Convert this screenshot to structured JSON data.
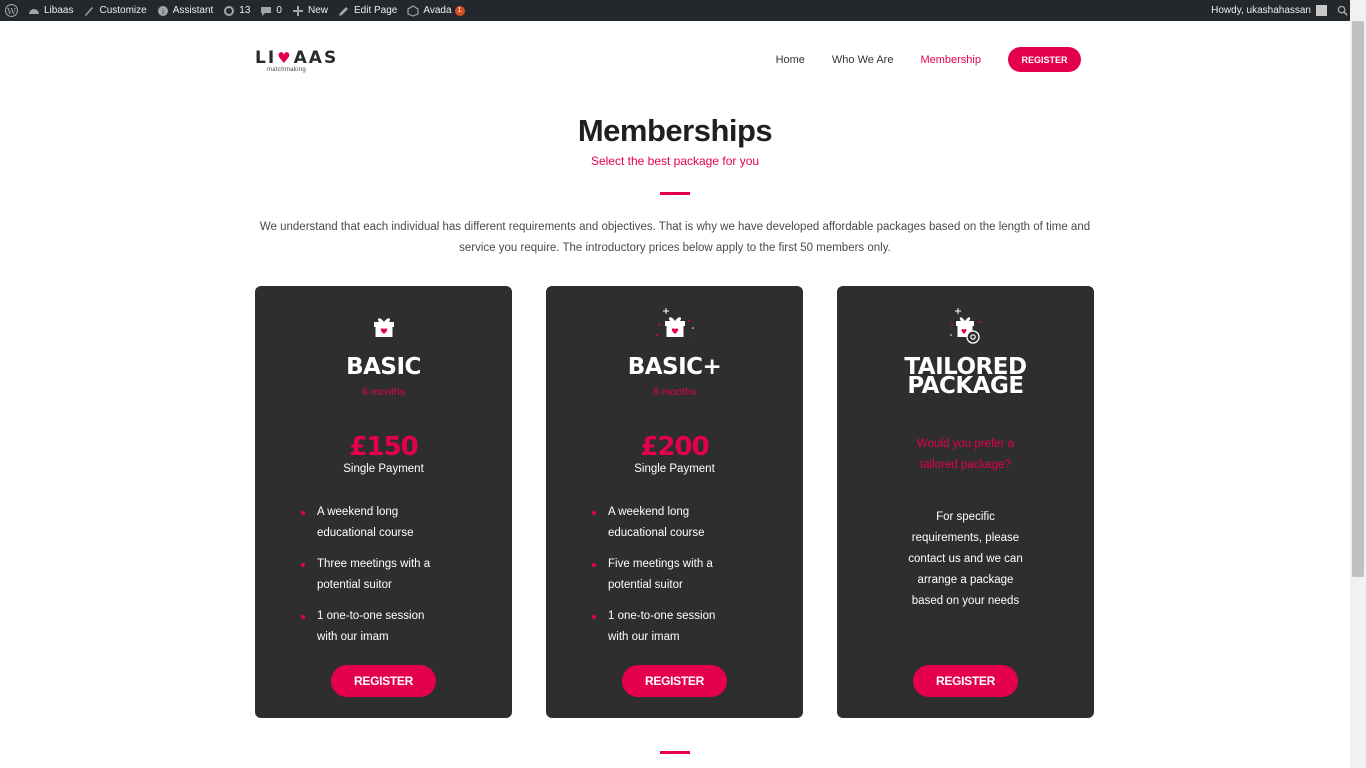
{
  "adminbar": {
    "items": [
      {
        "label": ""
      },
      {
        "label": "Libaas"
      },
      {
        "label": "Customize"
      },
      {
        "label": "Assistant"
      },
      {
        "label": "13"
      },
      {
        "label": "0"
      },
      {
        "label": "New"
      },
      {
        "label": "Edit Page"
      },
      {
        "label": "Avada",
        "badge": "1"
      }
    ],
    "greeting": "Howdy, ukashahassan"
  },
  "header": {
    "logo": {
      "word_left": "LI",
      "word_right": "AAS",
      "sub": "matchmaking"
    },
    "nav": [
      {
        "label": "Home",
        "active": false
      },
      {
        "label": "Who We Are",
        "active": false
      },
      {
        "label": "Membership",
        "active": true
      }
    ],
    "register_label": "REGISTER"
  },
  "hero": {
    "title": "Memberships",
    "subtitle": "Select the best package for you",
    "intro": "We understand that each individual has different requirements and objectives. That is why we have developed affordable packages based on the length of time and service you require. The introductory prices below apply to the first 50 members only."
  },
  "colors": {
    "accent": "#e5004d",
    "card_bg": "#2e2e2e",
    "adminbar_bg": "#23282d"
  },
  "cards": [
    {
      "icon": "gift-icon",
      "title": "BASIC",
      "duration": "6 months",
      "price": "£150",
      "payment": "Single Payment",
      "features": [
        "A weekend long educational course",
        "Three meetings with a potential suitor",
        "1 one-to-one session with our imam"
      ],
      "button": "REGISTER"
    },
    {
      "icon": "gift-sparkle-icon",
      "title": "BASIC+",
      "duration": "8 months",
      "price": "£200",
      "payment": "Single Payment",
      "features": [
        "A weekend long educational course",
        "Five meetings with a potential suitor",
        "1 one-to-one session with our imam"
      ],
      "button": "REGISTER"
    },
    {
      "icon": "gift-custom-icon",
      "title_line1": "TAILORED",
      "title_line2": "PACKAGE",
      "question": "Would you prefer a tailored package?",
      "description": "For specific requirements, please contact us and we can arrange a package based on your needs",
      "button": "REGISTER"
    }
  ]
}
